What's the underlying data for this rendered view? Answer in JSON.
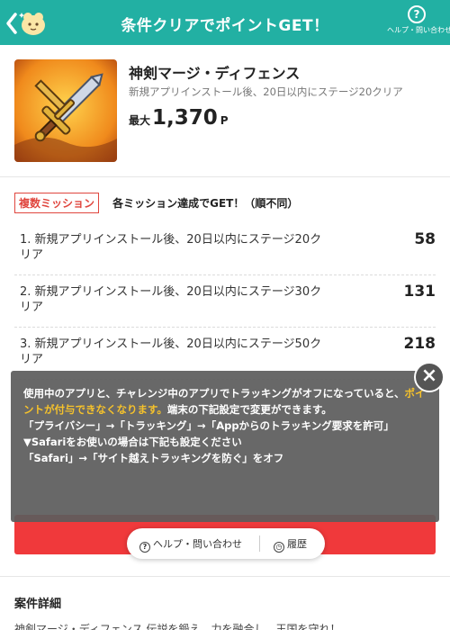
{
  "header": {
    "title": "条件クリアでポイントGET！",
    "help_label": "ヘルプ・問い合わせ",
    "help_icon": "question-circle-icon",
    "back_icon": "chevron-left-icon"
  },
  "app": {
    "name": "神剣マージ・ディフェンス",
    "subtitle": "新規アプリインストール後、20日以内にステージ20クリア",
    "reward_prefix": "最大",
    "reward_value": "1,370",
    "reward_unit": "P"
  },
  "missions": {
    "badge": "複数ミッション",
    "description": "各ミッション達成でGET！（順不同）",
    "items": [
      {
        "text": "1. 新規アプリインストール後、20日以内にステージ20クリア",
        "points": "58"
      },
      {
        "text": "2. 新規アプリインストール後、20日以内にステージ30クリア",
        "points": "131"
      },
      {
        "text": "3. 新規アプリインストール後、20日以内にステージ50クリア",
        "points": "218"
      }
    ]
  },
  "notice": {
    "line1_pre": "使用中のアプリと、チャレンジ中のアプリでトラッキングがオフになっていると、",
    "line1_highlight": "ポイントが付与できなくなります。",
    "line1_post": "端末の下記設定で変更ができます。",
    "line2": "「プライバシー」→「トラッキング」→「Appからのトラッキング要求を許可」",
    "line3": "▼Safariをお使いの場合は下記も設定ください",
    "line4": "「Safari」→「サイト越えトラッキングを防ぐ」をオフ"
  },
  "floating": {
    "help_label": "ヘルプ・問い合わせ",
    "history_label": "履歴"
  },
  "detail": {
    "title": "案件詳細",
    "text": "神剣マージ・ディフェンス 伝説を鍛え、力を融合し、王国を守れ！"
  },
  "colors": {
    "header": "#22b0a3",
    "accent_red": "#f0393b",
    "highlight": "#f6c22b"
  }
}
